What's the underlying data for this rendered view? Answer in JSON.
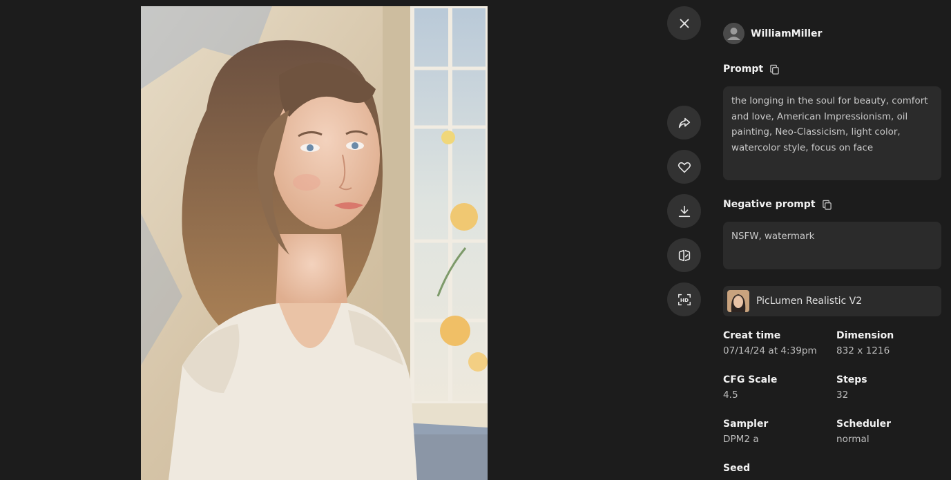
{
  "author": {
    "name": "WilliamMiller"
  },
  "prompt": {
    "label": "Prompt",
    "text": "the longing in the soul for beauty, comfort and love, American Impressionism, oil painting, Neo-Classicism, light color, watercolor style, focus on face"
  },
  "negative_prompt": {
    "label": "Negative prompt",
    "text": "NSFW, watermark"
  },
  "model": {
    "name": "PicLumen Realistic V2"
  },
  "meta": {
    "create_time": {
      "label": "Creat time",
      "value": "07/14/24 at 4:39pm"
    },
    "dimension": {
      "label": "Dimension",
      "value": "832 x 1216"
    },
    "cfg_scale": {
      "label": "CFG Scale",
      "value": "4.5"
    },
    "steps": {
      "label": "Steps",
      "value": "32"
    },
    "sampler": {
      "label": "Sampler",
      "value": "DPM2 a"
    },
    "scheduler": {
      "label": "Scheduler",
      "value": "normal"
    },
    "seed": {
      "label": "Seed"
    }
  },
  "icons": {
    "close": "close-icon",
    "share": "share-icon",
    "like": "heart-icon",
    "download": "download-icon",
    "compare": "compare-icon",
    "upscale": "hd-icon",
    "copy": "copy-icon"
  },
  "colors": {
    "background": "#1c1c1c",
    "panel_box": "#2b2b2b",
    "button": "#323232"
  }
}
